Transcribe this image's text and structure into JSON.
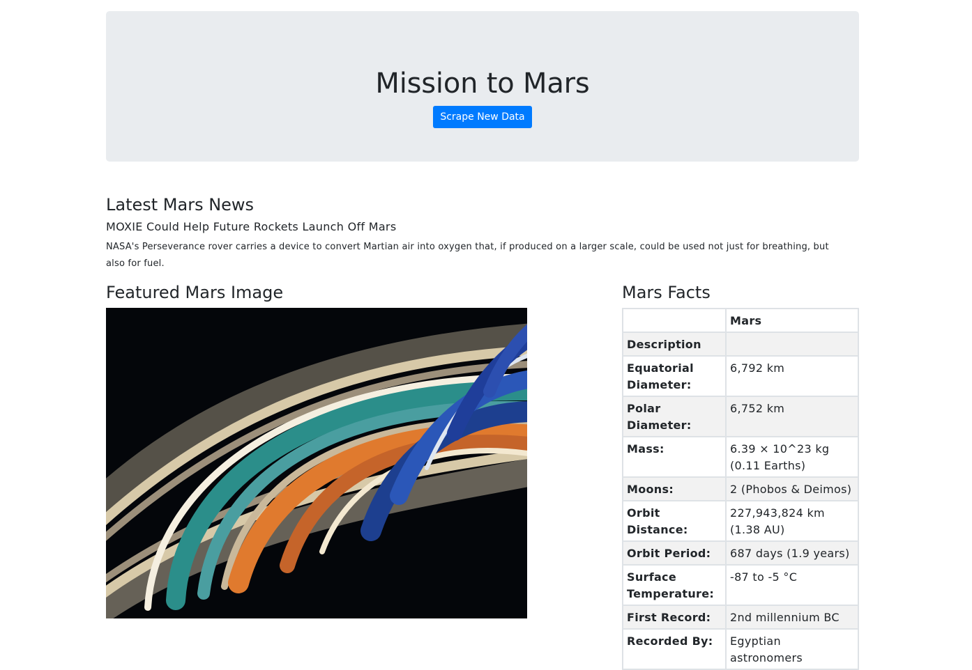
{
  "header": {
    "title": "Mission to Mars",
    "scrape_button": "Scrape New Data"
  },
  "news": {
    "section_title": "Latest Mars News",
    "headline": "MOXIE Could Help Future Rockets Launch Off Mars",
    "paragraph": "NASA's Perseverance rover carries a device to convert Martian air into oxygen that, if produced on a larger scale, could be used not just for breathing, but also for fuel."
  },
  "featured": {
    "section_title": "Featured Mars Image"
  },
  "facts": {
    "section_title": "Mars Facts",
    "header": [
      "",
      "Mars"
    ],
    "rows": [
      {
        "label": "Description",
        "value": ""
      },
      {
        "label": "Equatorial Diameter:",
        "value": "6,792 km"
      },
      {
        "label": "Polar Diameter:",
        "value": "6,752 km"
      },
      {
        "label": "Mass:",
        "value": "6.39 × 10^23 kg (0.11 Earths)"
      },
      {
        "label": "Moons:",
        "value": "2 (Phobos & Deimos)"
      },
      {
        "label": "Orbit Distance:",
        "value": "227,943,824 km (1.38 AU)"
      },
      {
        "label": "Orbit Period:",
        "value": "687 days (1.9 years)"
      },
      {
        "label": "Surface Temperature:",
        "value": "-87 to -5 °C"
      },
      {
        "label": "First Record:",
        "value": "2nd millennium BC"
      },
      {
        "label": "Recorded By:",
        "value": "Egyptian astronomers"
      }
    ]
  }
}
